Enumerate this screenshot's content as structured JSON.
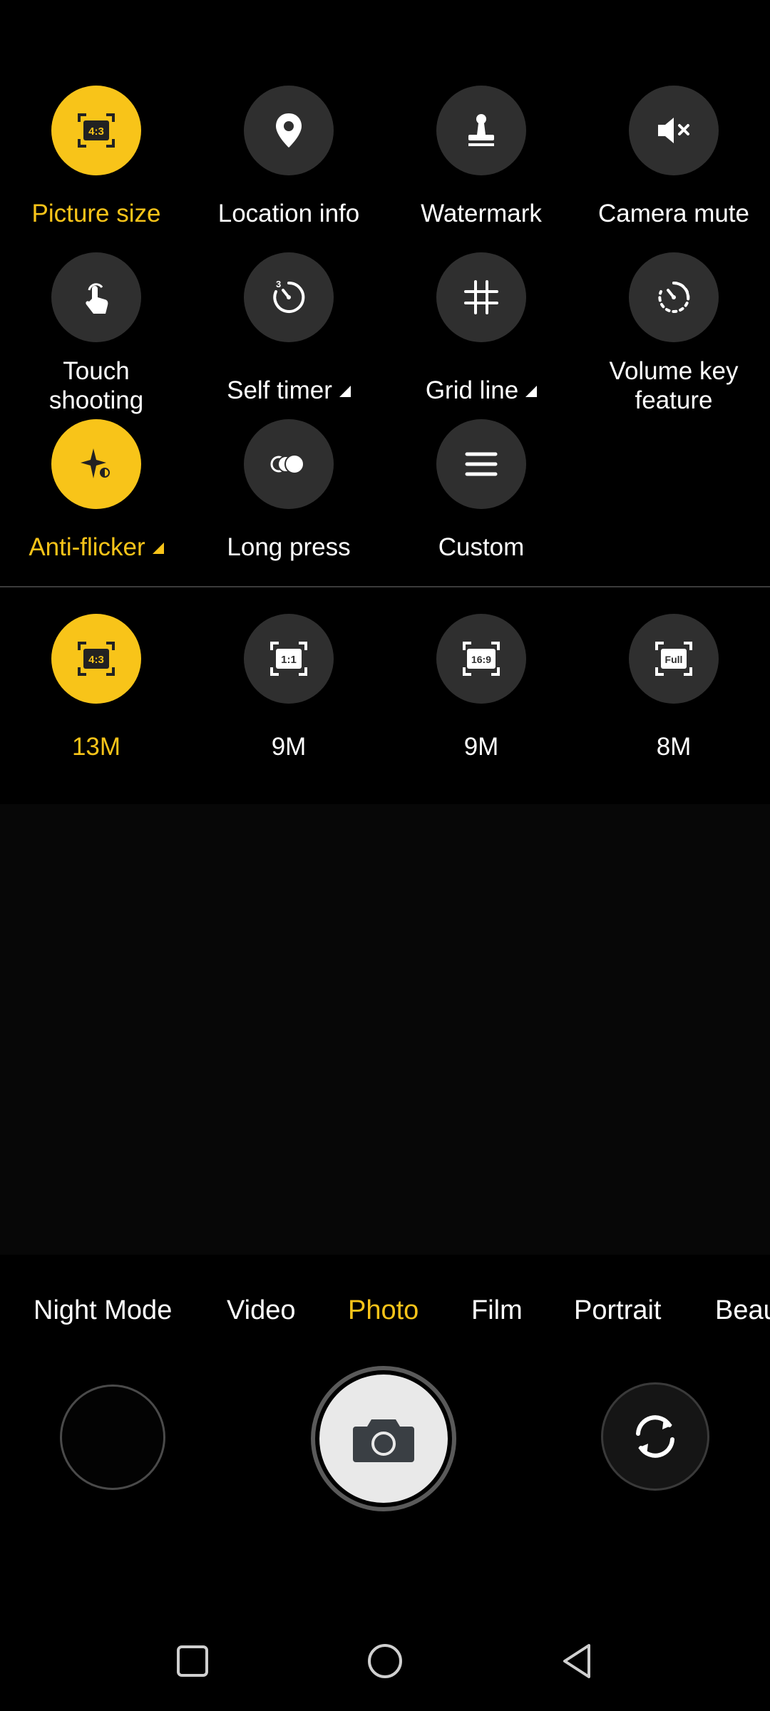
{
  "settings": {
    "row1": [
      {
        "label": "Picture size",
        "icon": "aspect-4-3-icon",
        "icon_text": "4:3",
        "active": true
      },
      {
        "label": "Location info",
        "icon": "location-pin-icon",
        "active": false
      },
      {
        "label": "Watermark",
        "icon": "stamp-icon",
        "active": false
      },
      {
        "label": "Camera mute",
        "icon": "volume-mute-icon",
        "active": false
      }
    ],
    "row2": [
      {
        "label_line1": "Touch",
        "label_line2": "shooting",
        "icon": "touch-icon",
        "active": false
      },
      {
        "label": "Self timer",
        "icon": "timer-icon",
        "icon_text": "3",
        "active": false
      },
      {
        "label": "Grid line",
        "icon": "grid-icon",
        "active": false
      },
      {
        "label_line1": "Volume key",
        "label_line2": "feature",
        "icon": "volume-key-icon",
        "active": false
      }
    ],
    "row3": [
      {
        "label": "Anti-flicker",
        "icon": "anti-flicker-icon",
        "active": true
      },
      {
        "label": "Long press",
        "icon": "long-press-icon",
        "active": false
      },
      {
        "label": "Custom",
        "icon": "menu-icon",
        "active": false
      }
    ]
  },
  "picture_sizes": [
    {
      "ratio": "4:3",
      "label": "13M",
      "active": true
    },
    {
      "ratio": "1:1",
      "label": "9M",
      "active": false
    },
    {
      "ratio": "16:9",
      "label": "9M",
      "active": false
    },
    {
      "ratio": "Full",
      "label": "8M",
      "active": false
    }
  ],
  "modes": [
    "Night Mode",
    "Video",
    "Photo",
    "Film",
    "Portrait",
    "Beau"
  ],
  "active_mode": "Photo",
  "colors": {
    "accent": "#f8c419",
    "circle_bg": "#2f2f2f",
    "background": "#000000"
  }
}
